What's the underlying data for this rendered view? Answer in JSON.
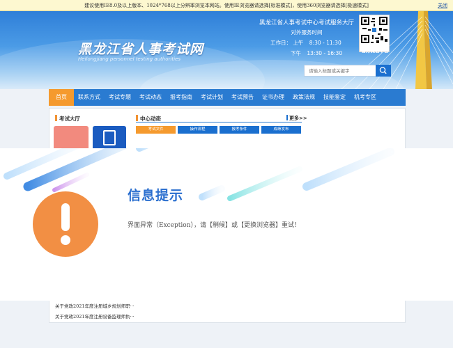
{
  "notice": {
    "text": "建议使用IE8.0及以上版本、1024*768以上分辨率浏览本网站。使用IE浏览器请选择[标准模式]，使用360浏览器请选择[极速模式]",
    "close_label": "关闭"
  },
  "header": {
    "site_title": "黑龙江省人事考试网",
    "site_subtitle": "Heilongjiang personnel testing authorities",
    "service": {
      "title": "黑龙江省人事考试中心考试服务大厅",
      "subtitle": "对外服务时间",
      "workday_label": "工作日：",
      "am_label": "上午",
      "am_time": "8:30 - 11:30",
      "pm_label": "下午",
      "pm_time": "13:30 - 16:30"
    },
    "qr_label": "官方微信平台",
    "search_placeholder": "请输入标题或关键字"
  },
  "nav": {
    "items": [
      "首页",
      "联系方式",
      "考试专题",
      "考试动态",
      "报考指南",
      "考试计划",
      "考试预告",
      "证书办理",
      "政策法规",
      "技能鉴定",
      "机考专区"
    ],
    "active_index": 0
  },
  "panel": {
    "hall_title": "考试大厅",
    "center_title": "中心动态",
    "more_label": "更多>>",
    "subtabs": [
      "考试文件",
      "操作流程",
      "报考条件",
      "成绩发布"
    ],
    "news": [
      "关于党政2021年度注册城乡规划师职···",
      "关于党政2021年度注册设备监理师执···"
    ]
  },
  "error": {
    "title": "信息提示",
    "message": "界面异常（Exception），请【稍候】或【更换浏览器】重试！"
  },
  "colors": {
    "nav_blue": "#2a7bd1",
    "accent_orange": "#f59a2e",
    "title_blue": "#2b6fcf"
  }
}
